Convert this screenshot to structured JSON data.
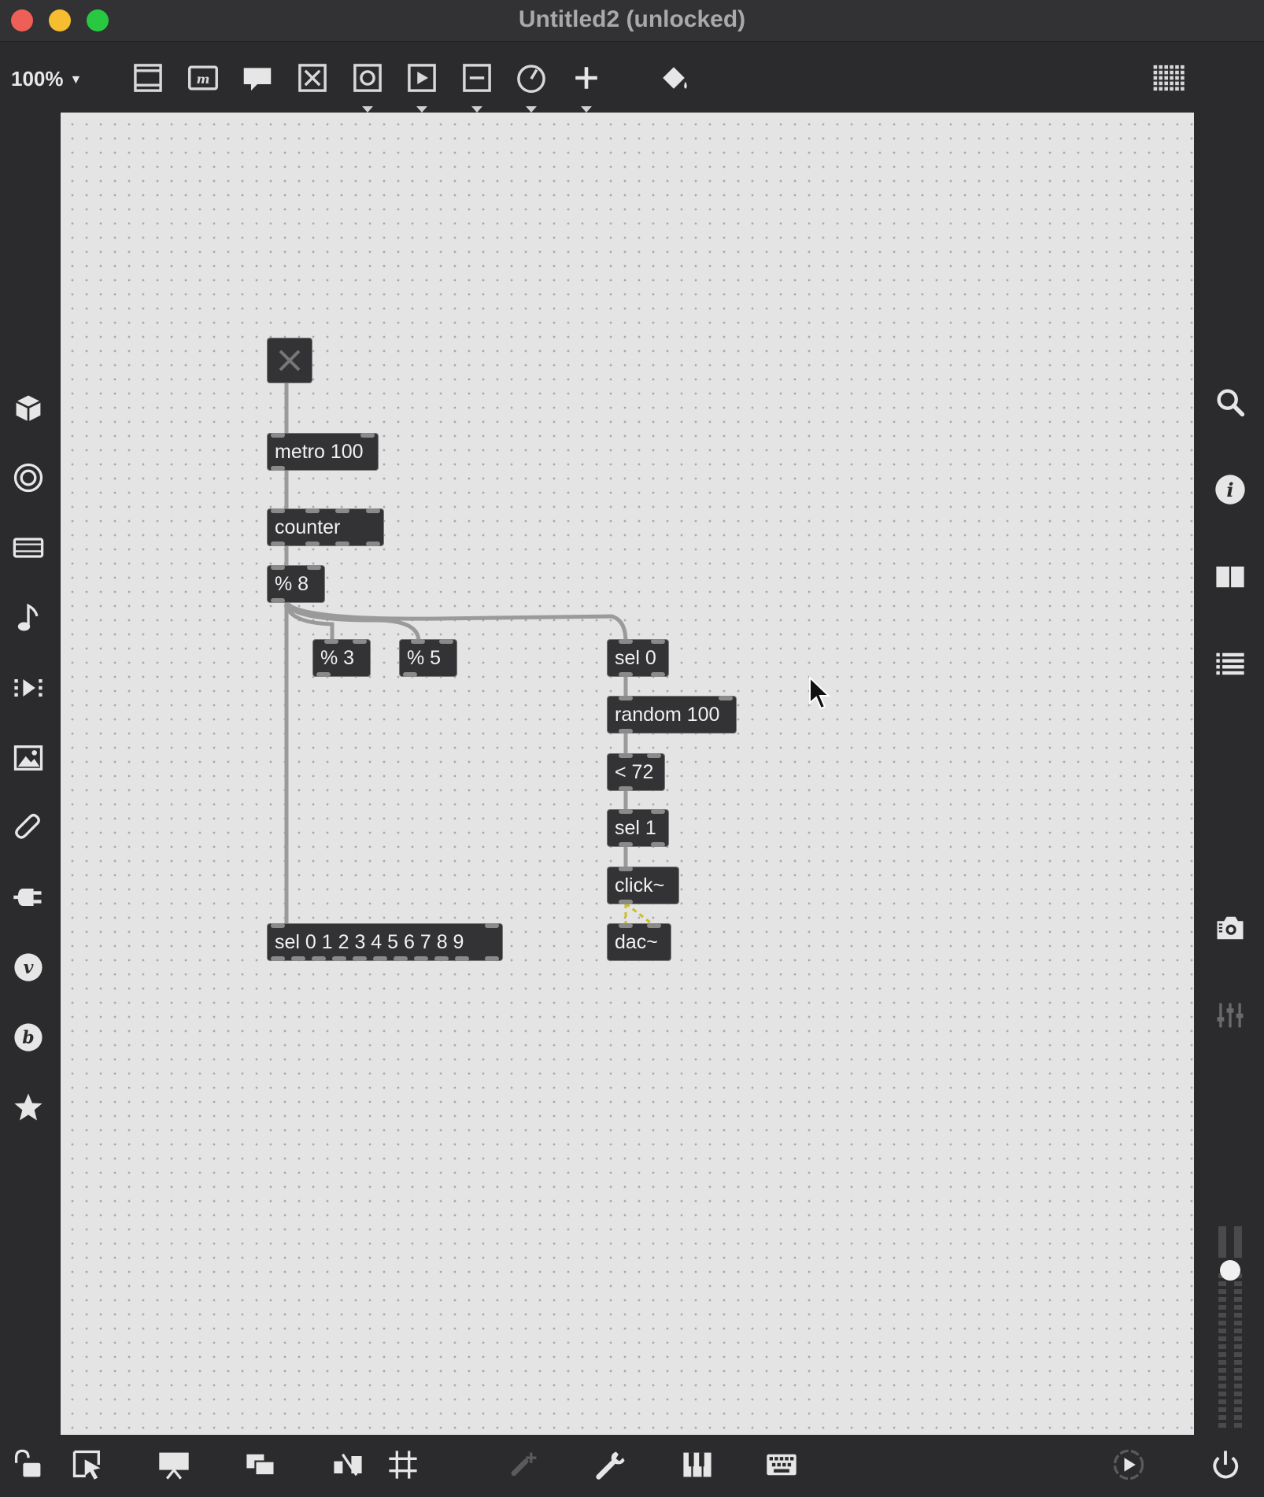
{
  "window": {
    "title": "Untitled2 (unlocked)"
  },
  "toolbar": {
    "zoom": "100%",
    "icons": [
      "presentation-icon",
      "message-box-icon",
      "comment-icon",
      "toggle-object-icon",
      "button-object-icon",
      "play-object-icon",
      "slider-object-icon",
      "dial-object-icon",
      "add-object-icon",
      "paint-bucket-icon",
      "grid-keyboard-icon"
    ]
  },
  "left_sidebar": {
    "icons": [
      "cube-icon",
      "target-icon",
      "film-icon",
      "music-note-icon",
      "step-forward-icon",
      "image-icon",
      "paperclip-icon",
      "plug-icon",
      "v-logo-icon",
      "b-logo-icon",
      "star-icon"
    ]
  },
  "right_sidebar": {
    "icons": [
      "search-icon",
      "info-icon",
      "columns-icon",
      "list-icon",
      "snapshot-icon",
      "mixer-icon"
    ],
    "volume_level": 0.9
  },
  "bottom_bar": {
    "icons": [
      "lock-icon",
      "select-icon",
      "presentation-mode-icon",
      "layers-icon",
      "patch-cord-icon",
      "grid-icon",
      "add-connection-icon",
      "wrench-icon",
      "piano-icon",
      "keyboard-icon",
      "play-circle-icon",
      "power-icon"
    ]
  },
  "patch": {
    "objects": {
      "metro": "metro 100",
      "counter": "counter",
      "mod8": "% 8",
      "mod3": "% 3",
      "mod5": "% 5",
      "sel0": "sel 0",
      "random": "random 100",
      "lt72": "< 72",
      "sel1": "sel 1",
      "click": "click~",
      "dac": "dac~",
      "selmany": "sel 0 1 2 3 4 5 6 7 8 9"
    }
  },
  "colors": {
    "canvas": "#e4e4e4",
    "object_bg": "#333335",
    "window_bg": "#2b2b2d",
    "close": "#ee5f57",
    "minimize": "#f5bd2f",
    "maximize": "#28c840"
  }
}
